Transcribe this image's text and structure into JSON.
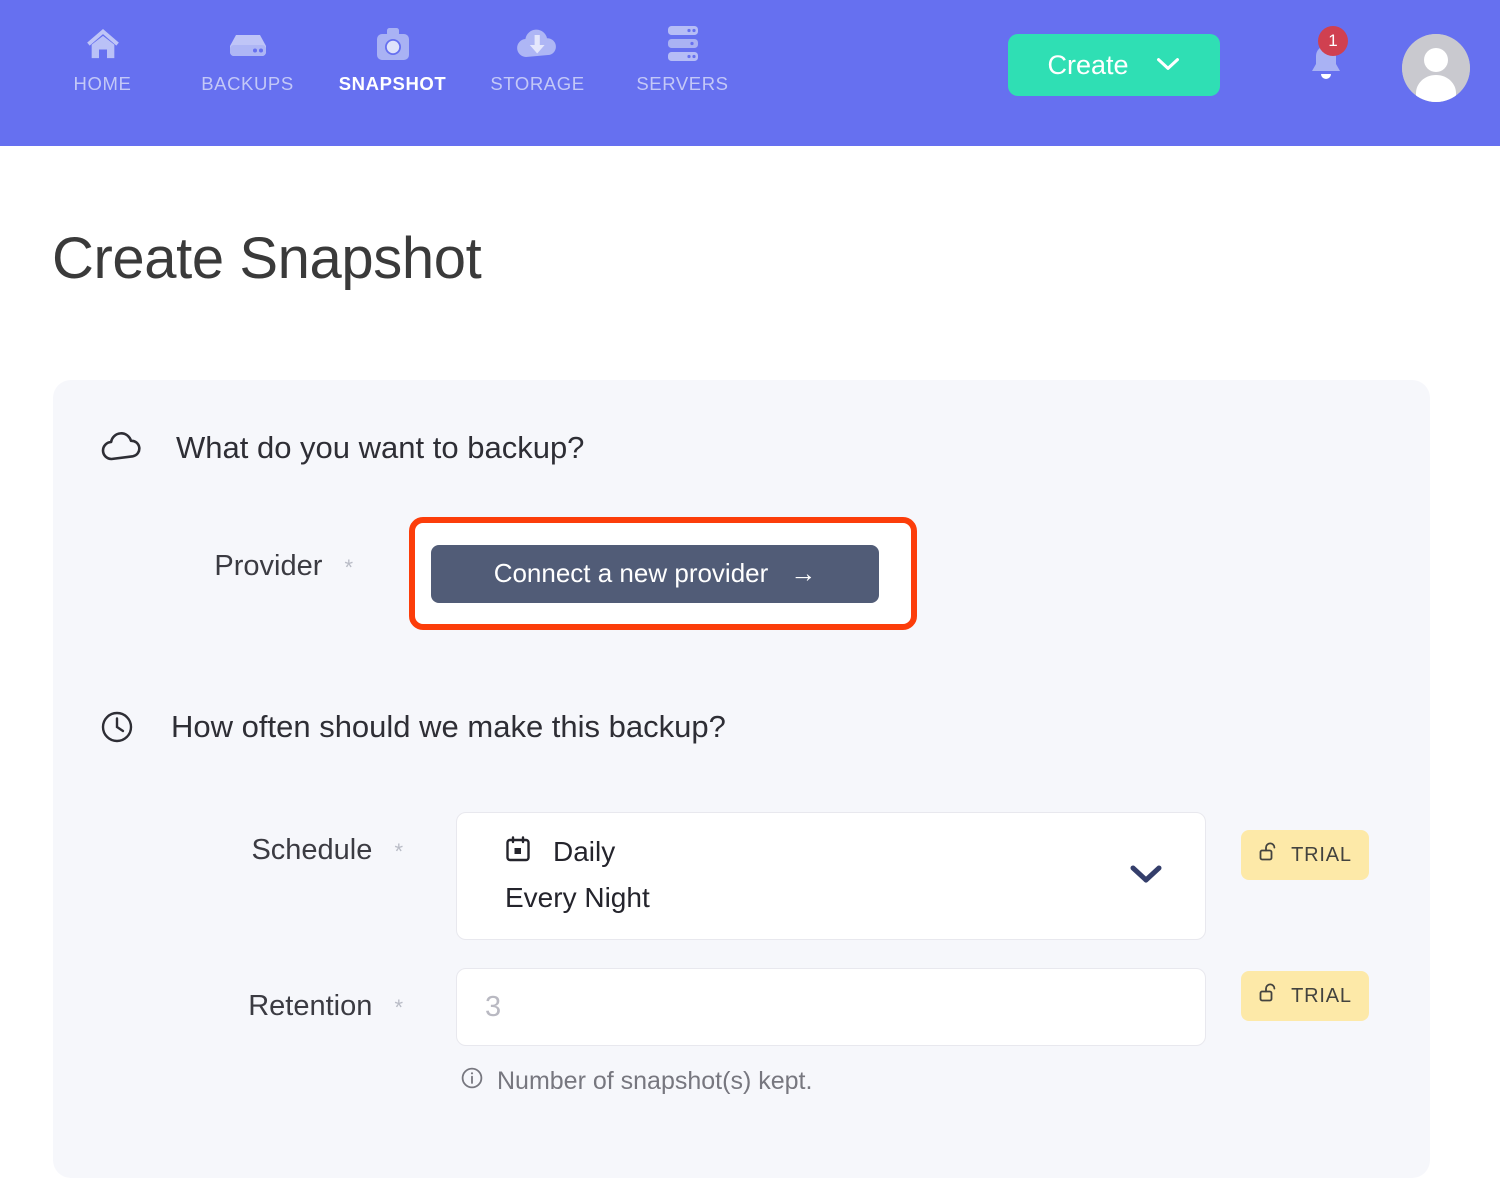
{
  "nav": {
    "items": [
      {
        "label": "HOME",
        "icon": "home-icon",
        "active": false
      },
      {
        "label": "BACKUPS",
        "icon": "hard-drive-icon",
        "active": false
      },
      {
        "label": "SNAPSHOT",
        "icon": "camera-icon",
        "active": true
      },
      {
        "label": "STORAGE",
        "icon": "cloud-download-icon",
        "active": false
      },
      {
        "label": "SERVERS",
        "icon": "servers-icon",
        "active": false
      }
    ],
    "create_button": {
      "label": "Create",
      "icon": "chevron-down-icon"
    },
    "notifications": {
      "count": "1",
      "icon": "bell-icon"
    },
    "avatar": {
      "icon": "user-avatar-icon"
    },
    "colors": {
      "bar": "#6670f0",
      "create": "#2fdfb4",
      "badge": "#d04050",
      "label_inactive": "#c3c8f7"
    }
  },
  "page": {
    "title": "Create Snapshot"
  },
  "card": {
    "sections": [
      {
        "icon": "cloud-icon",
        "title": "What do you want to backup?"
      },
      {
        "icon": "clock-icon",
        "title": "How often should we make this backup?"
      }
    ],
    "provider": {
      "label": "Provider",
      "required_mark": "*",
      "button_label": "Connect a new provider",
      "button_icon": "arrow-right-icon",
      "highlight_color": "#fc3d0a",
      "button_color": "#515c77"
    },
    "schedule": {
      "label": "Schedule",
      "required_mark": "*",
      "icon": "calendar-icon",
      "value": "Daily",
      "sub_value": "Every Night",
      "chevron_icon": "chevron-down-icon",
      "trial_badge": {
        "label": "TRIAL",
        "icon": "unlock-icon",
        "color": "#fde9a8"
      }
    },
    "retention": {
      "label": "Retention",
      "required_mark": "*",
      "placeholder": "3",
      "value": "",
      "helper_text": "Number of snapshot(s) kept.",
      "helper_icon": "info-icon",
      "trial_badge": {
        "label": "TRIAL",
        "icon": "unlock-icon",
        "color": "#fde9a8"
      }
    }
  }
}
